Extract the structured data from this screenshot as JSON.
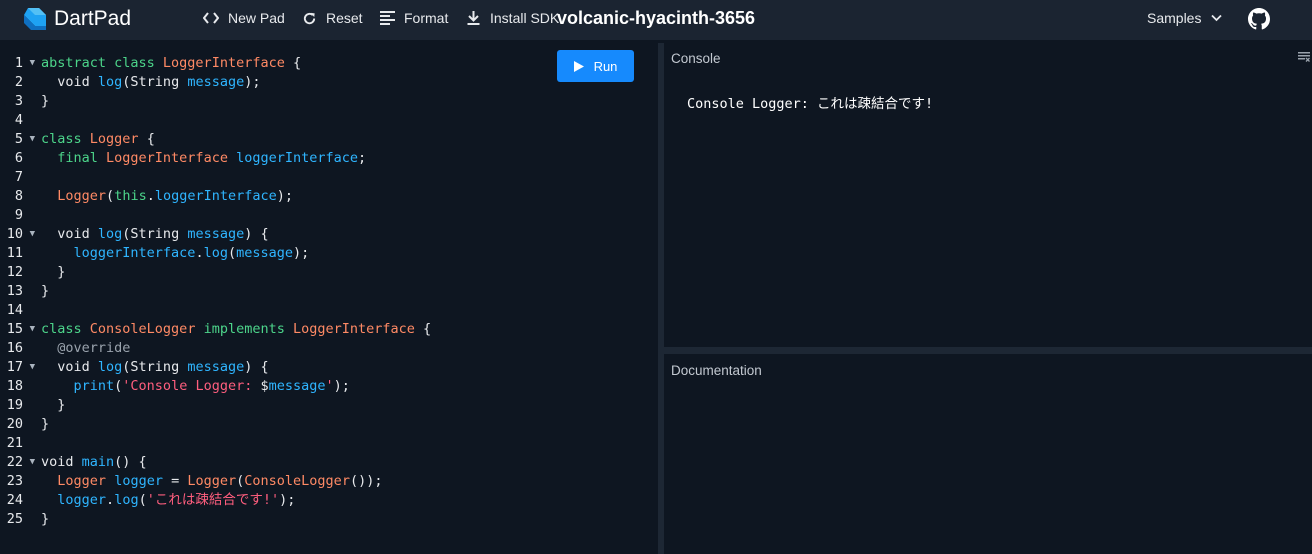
{
  "app": {
    "brand": "DartPad",
    "pad_name": "volcanic-hyacinth-3656"
  },
  "toolbar": {
    "new_pad": "New Pad",
    "reset": "Reset",
    "format": "Format",
    "install_sdk": "Install SDK",
    "samples": "Samples"
  },
  "editor": {
    "run_label": "Run",
    "lines": [
      {
        "n": "1",
        "fold": true,
        "tokens": [
          [
            "abstract class ",
            "kw"
          ],
          [
            "LoggerInterface",
            "type"
          ],
          [
            " {",
            "p"
          ]
        ]
      },
      {
        "n": "2",
        "fold": false,
        "tokens": [
          [
            "  void ",
            "p"
          ],
          [
            "log",
            "fn"
          ],
          [
            "(String ",
            "p"
          ],
          [
            "message",
            "var"
          ],
          [
            ");",
            "p"
          ]
        ]
      },
      {
        "n": "3",
        "fold": false,
        "tokens": [
          [
            "}",
            "p"
          ]
        ]
      },
      {
        "n": "4",
        "fold": false,
        "tokens": []
      },
      {
        "n": "5",
        "fold": true,
        "tokens": [
          [
            "class ",
            "kw"
          ],
          [
            "Logger",
            "type"
          ],
          [
            " {",
            "p"
          ]
        ]
      },
      {
        "n": "6",
        "fold": false,
        "tokens": [
          [
            "  final ",
            "kw"
          ],
          [
            "LoggerInterface",
            "type"
          ],
          [
            " ",
            "p"
          ],
          [
            "loggerInterface",
            "var"
          ],
          [
            ";",
            "p"
          ]
        ]
      },
      {
        "n": "7",
        "fold": false,
        "tokens": []
      },
      {
        "n": "8",
        "fold": false,
        "tokens": [
          [
            "  ",
            "p"
          ],
          [
            "Logger",
            "type"
          ],
          [
            "(",
            "p"
          ],
          [
            "this",
            "kw"
          ],
          [
            ".",
            "p"
          ],
          [
            "loggerInterface",
            "var"
          ],
          [
            ");",
            "p"
          ]
        ]
      },
      {
        "n": "9",
        "fold": false,
        "tokens": []
      },
      {
        "n": "10",
        "fold": true,
        "tokens": [
          [
            "  void ",
            "p"
          ],
          [
            "log",
            "fn"
          ],
          [
            "(String ",
            "p"
          ],
          [
            "message",
            "var"
          ],
          [
            ") {",
            "p"
          ]
        ]
      },
      {
        "n": "11",
        "fold": false,
        "tokens": [
          [
            "    ",
            "p"
          ],
          [
            "loggerInterface",
            "var"
          ],
          [
            ".",
            "p"
          ],
          [
            "log",
            "fn"
          ],
          [
            "(",
            "p"
          ],
          [
            "message",
            "var"
          ],
          [
            ");",
            "p"
          ]
        ]
      },
      {
        "n": "12",
        "fold": false,
        "tokens": [
          [
            "  }",
            "p"
          ]
        ]
      },
      {
        "n": "13",
        "fold": false,
        "tokens": [
          [
            "}",
            "p"
          ]
        ]
      },
      {
        "n": "14",
        "fold": false,
        "tokens": []
      },
      {
        "n": "15",
        "fold": true,
        "tokens": [
          [
            "class ",
            "kw"
          ],
          [
            "ConsoleLogger",
            "type"
          ],
          [
            " implements ",
            "kw"
          ],
          [
            "LoggerInterface",
            "type"
          ],
          [
            " {",
            "p"
          ]
        ]
      },
      {
        "n": "16",
        "fold": false,
        "tokens": [
          [
            "  @override",
            "meta"
          ]
        ]
      },
      {
        "n": "17",
        "fold": true,
        "tokens": [
          [
            "  void ",
            "p"
          ],
          [
            "log",
            "fn"
          ],
          [
            "(String ",
            "p"
          ],
          [
            "message",
            "var"
          ],
          [
            ") {",
            "p"
          ]
        ]
      },
      {
        "n": "18",
        "fold": false,
        "tokens": [
          [
            "    ",
            "p"
          ],
          [
            "print",
            "fn"
          ],
          [
            "(",
            "p"
          ],
          [
            "'Console Logger: ",
            "str"
          ],
          [
            "$",
            "p"
          ],
          [
            "message",
            "var"
          ],
          [
            "'",
            "str"
          ],
          [
            ");",
            "p"
          ]
        ]
      },
      {
        "n": "19",
        "fold": false,
        "tokens": [
          [
            "  }",
            "p"
          ]
        ]
      },
      {
        "n": "20",
        "fold": false,
        "tokens": [
          [
            "}",
            "p"
          ]
        ]
      },
      {
        "n": "21",
        "fold": false,
        "tokens": []
      },
      {
        "n": "22",
        "fold": true,
        "tokens": [
          [
            "void ",
            "p"
          ],
          [
            "main",
            "fn"
          ],
          [
            "() {",
            "p"
          ]
        ]
      },
      {
        "n": "23",
        "fold": false,
        "tokens": [
          [
            "  ",
            "p"
          ],
          [
            "Logger",
            "type"
          ],
          [
            " ",
            "p"
          ],
          [
            "logger",
            "var"
          ],
          [
            " = ",
            "p"
          ],
          [
            "Logger",
            "type"
          ],
          [
            "(",
            "p"
          ],
          [
            "ConsoleLogger",
            "type"
          ],
          [
            "());",
            "p"
          ]
        ]
      },
      {
        "n": "24",
        "fold": false,
        "tokens": [
          [
            "  ",
            "p"
          ],
          [
            "logger",
            "var"
          ],
          [
            ".",
            "p"
          ],
          [
            "log",
            "fn"
          ],
          [
            "(",
            "p"
          ],
          [
            "'これは疎結合です!'",
            "str"
          ],
          [
            ");",
            "p"
          ]
        ]
      },
      {
        "n": "25",
        "fold": false,
        "tokens": [
          [
            "}",
            "p"
          ]
        ]
      }
    ]
  },
  "console": {
    "label": "Console",
    "output": "Console Logger: これは疎結合です!"
  },
  "documentation": {
    "label": "Documentation"
  },
  "colors": {
    "kw": "#4cd48a",
    "type": "#ff8a65",
    "fn": "#2fb5ff",
    "var": "#2fb5ff",
    "str": "#ff5e7e",
    "meta": "#9aa3ad",
    "p": "#e8eaed"
  },
  "icons": [
    "dart-logo-icon",
    "code-icon",
    "refresh-icon",
    "format-icon",
    "download-icon",
    "play-icon",
    "chevron-down-icon",
    "github-icon",
    "clear-console-icon"
  ]
}
